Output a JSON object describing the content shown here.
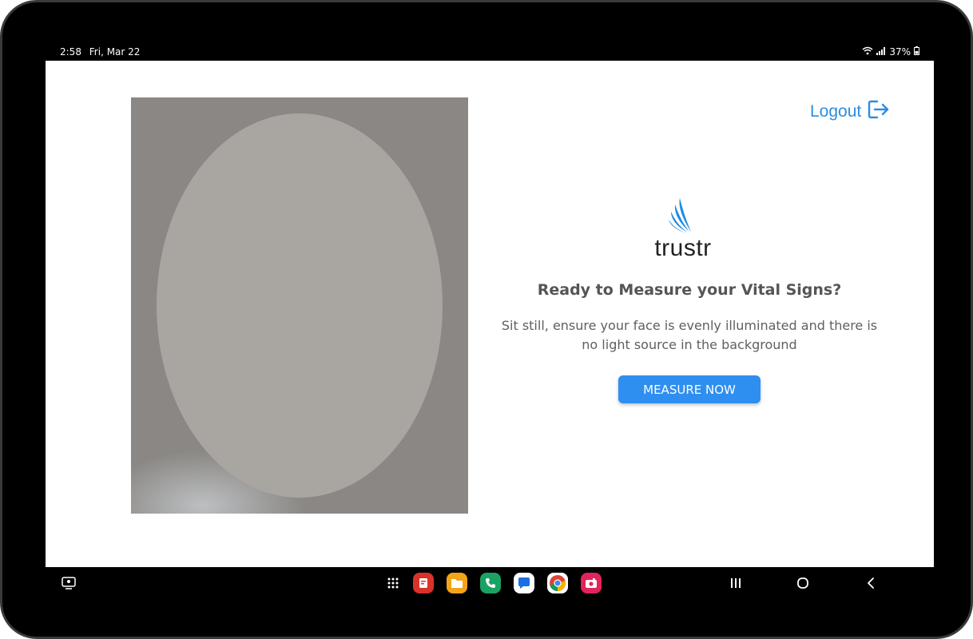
{
  "status": {
    "time": "2:58",
    "date": "Fri, Mar 22",
    "battery": "37%"
  },
  "header": {
    "logout_label": "Logout"
  },
  "brand": {
    "name": "trustr"
  },
  "main": {
    "headline": "Ready to Measure your Vital Signs?",
    "instruction_line1": "Sit still, ensure your face is evenly illuminated and there is",
    "instruction_line2": "no light source in the background",
    "measure_label": "MEASURE NOW"
  },
  "colors": {
    "accent": "#2e8ff0",
    "link": "#2b8de3"
  },
  "navbar": {
    "apps": [
      "app-drawer-icon",
      "notes-app-icon",
      "files-app-icon",
      "phone-app-icon",
      "messages-app-icon",
      "chrome-app-icon",
      "camera-app-icon"
    ],
    "buttons": [
      "recents-icon",
      "home-icon",
      "back-icon"
    ]
  }
}
